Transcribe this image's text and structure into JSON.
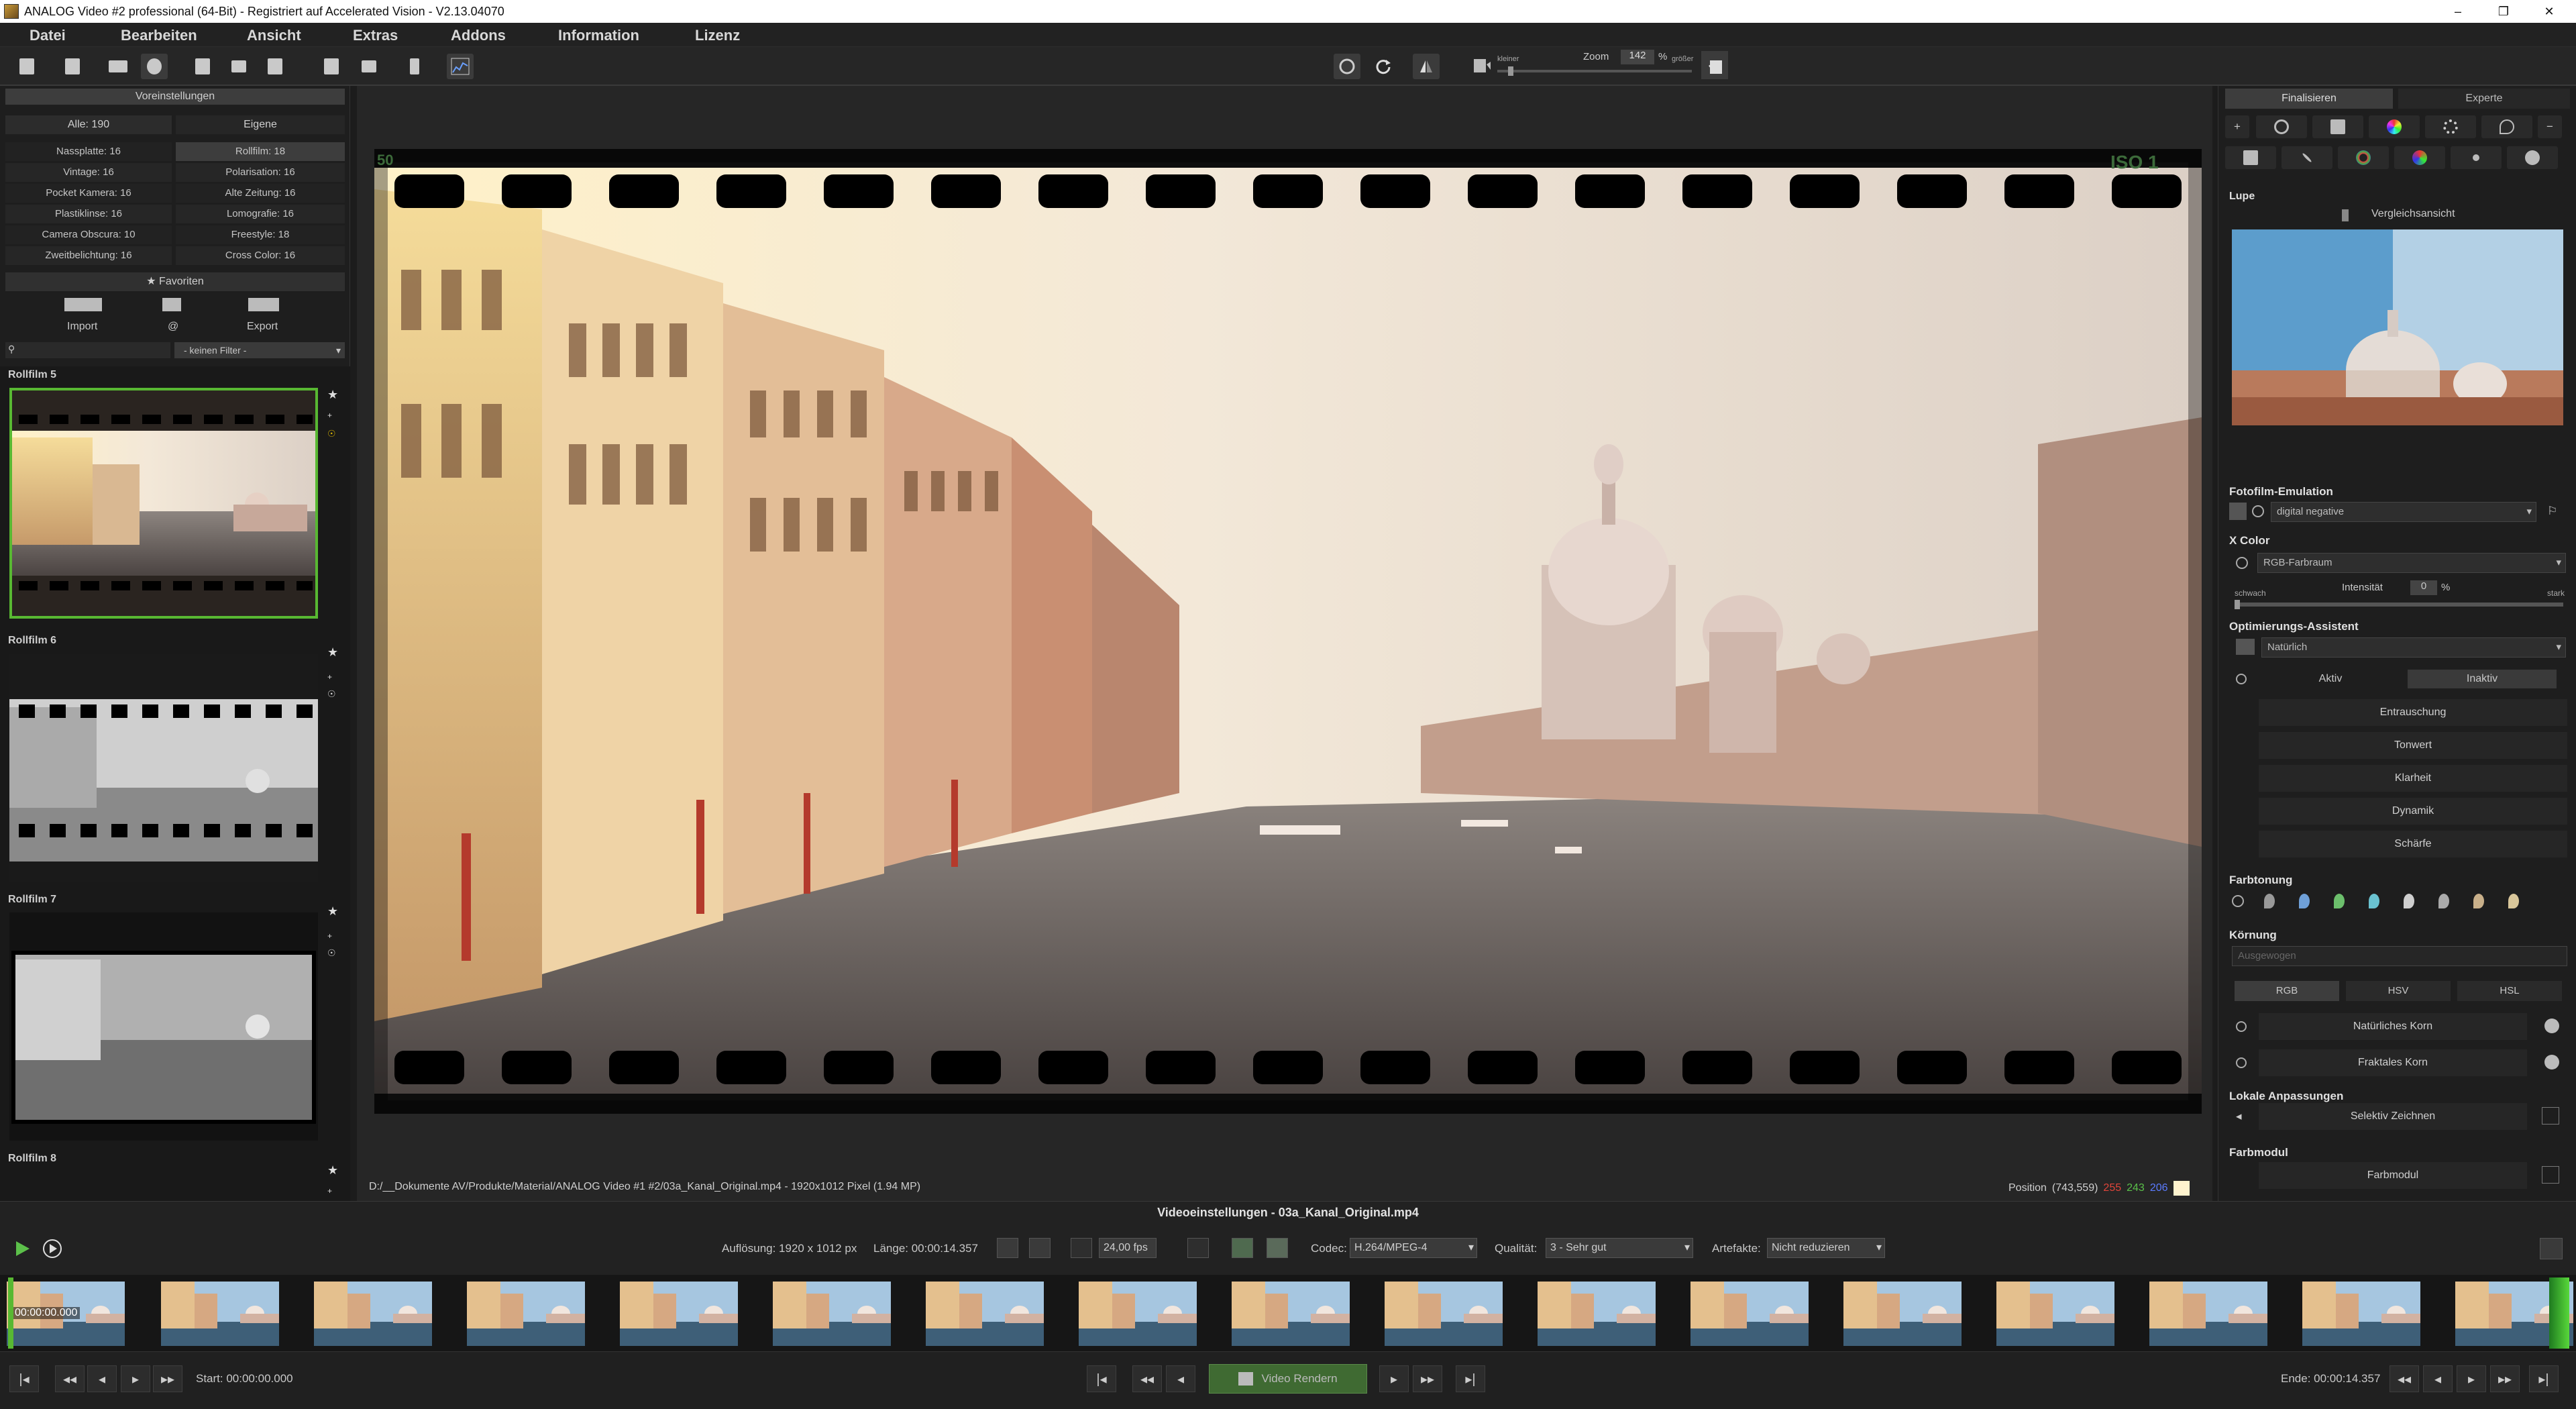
{
  "window": {
    "title": "ANALOG Video #2 professional (64-Bit) - Registriert auf Accelerated Vision - V2.13.04070",
    "controls": [
      "–",
      "❐",
      "✕"
    ]
  },
  "menu": [
    "Datei",
    "Bearbeiten",
    "Ansicht",
    "Extras",
    "Addons",
    "Information",
    "Lizenz"
  ],
  "toolbar": {
    "zoom_label": "Zoom",
    "zoom_value": "142",
    "zoom_unit": "%",
    "smaller": "kleiner",
    "larger": "größer"
  },
  "left": {
    "header": "Voreinstellungen",
    "tab_all": "Alle: 190",
    "tab_own": "Eigene",
    "presets": [
      [
        "Nassplatte: 16",
        "Rollfilm: 18"
      ],
      [
        "Vintage: 16",
        "Polarisation: 16"
      ],
      [
        "Pocket Kamera: 16",
        "Alte Zeitung: 16"
      ],
      [
        "Plastiklinse: 16",
        "Lomografie: 16"
      ],
      [
        "Camera Obscura: 10",
        "Freestyle: 18"
      ],
      [
        "Zweitbelichtung: 16",
        "Cross Color: 16"
      ]
    ],
    "favorites": "★ Favoriten",
    "import": "Import",
    "at": "@",
    "export": "Export",
    "filter": "- keinen Filter -",
    "gallery": [
      "Rollfilm 5",
      "Rollfilm 6",
      "Rollfilm 7",
      "Rollfilm 8"
    ]
  },
  "center": {
    "filepath": "D:/__Dokumente AV/Produkte/Material/ANALOG Video #1 #2/03a_Kanal_Original.mp4 - 1920x1012 Pixel (1.94 MP)",
    "position_label": "Position",
    "position_value": "(743,559)",
    "pos_r": "255",
    "pos_g": "243",
    "pos_b": "206",
    "iso_mark": "ISO 1",
    "edge_mark": "50"
  },
  "right": {
    "tab_finalize": "Finalisieren",
    "tab_expert": "Experte",
    "lupe": "Lupe",
    "compare": "Vergleichsansicht",
    "emulation_title": "Fotofilm-Emulation",
    "emulation_value": "digital negative",
    "xcolor_title": "X Color",
    "xcolor_value": "RGB-Farbraum",
    "weak": "schwach",
    "intensity": "Intensität",
    "intensity_value": "0",
    "intensity_unit": "%",
    "strong": "stark",
    "assistant_title": "Optimierungs-Assistent",
    "assistant_value": "Natürlich",
    "active": "Aktiv",
    "inactive": "Inaktiv",
    "assist_items": [
      "Entrauschung",
      "Tonwert",
      "Klarheit",
      "Dynamik",
      "Schärfe"
    ],
    "toning_title": "Farbtonung",
    "grain_title": "Körnung",
    "grain_value": "Ausgewogen",
    "grain_modes": [
      "RGB",
      "HSV",
      "HSL"
    ],
    "grain_items": [
      "Natürliches Korn",
      "Fraktales Korn"
    ],
    "local_title": "Lokale Anpassungen",
    "local_item": "Selektiv Zeichnen",
    "colormod_title": "Farbmodul",
    "colormod_item": "Farbmodul"
  },
  "video": {
    "title": "Videoeinstellungen - 03a_Kanal_Original.mp4",
    "resolution": "Auflösung: 1920 x 1012 px",
    "length": "Länge: 00:00:14.357",
    "fps": "24,00 fps",
    "codec_label": "Codec:",
    "codec": "H.264/MPEG-4",
    "quality_label": "Qualität:",
    "quality": "3 - Sehr gut",
    "artifacts_label": "Artefakte:",
    "artifacts": "Nicht reduzieren",
    "timecode": "00:00:00.000",
    "start": "Start: 00:00:00.000",
    "render": "Video Rendern",
    "end": "Ende: 00:00:14.357"
  },
  "colors": {
    "accent_green": "#58b832",
    "render_green": "#3f6a32"
  }
}
